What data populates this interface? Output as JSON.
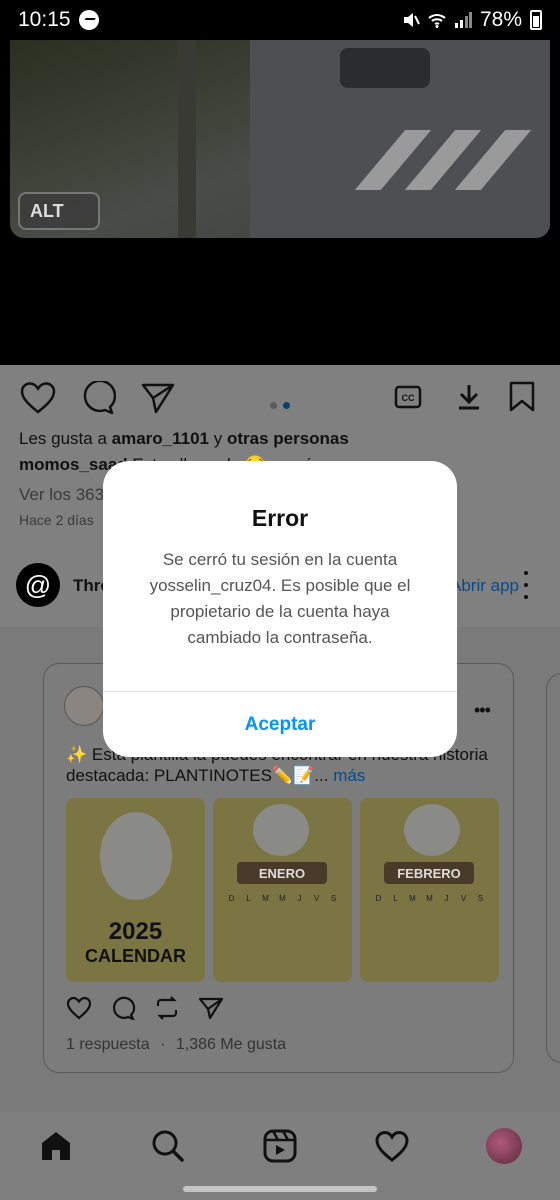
{
  "status_bar": {
    "time": "10:15",
    "battery": "78%",
    "icons": [
      "messenger-icon",
      "mute-icon",
      "wifi-icon",
      "signal-icon",
      "battery-icon"
    ]
  },
  "post": {
    "alt_badge": "ALT",
    "carousel": {
      "total": 2,
      "active": 1
    },
    "likes_prefix": "Les gusta a ",
    "likes_user": "amaro_1101",
    "likes_mid": " y ",
    "likes_others": "otras personas",
    "caption_user": "momos_saad",
    "caption_text": " Estoy llorando 😂 ... más",
    "comments_link": "Ver los 363 comentarios",
    "time_ago": "Hace 2 días"
  },
  "threads": {
    "name": "Threads",
    "open_app": "Abrir app",
    "post_text": "✨ Esta plantilla la puedes encontrar en nuestra historia destacada: PLANTINOTES✏️📝...",
    "more_link": " más",
    "images": [
      {
        "title_line1": "2025",
        "title_line2": "CALENDAR"
      },
      {
        "month": "ENERO"
      },
      {
        "month": "FEBRERO"
      }
    ],
    "weekdays": [
      "D",
      "L",
      "M",
      "M",
      "J",
      "V",
      "S"
    ],
    "replies": "1 respuesta",
    "separator": "·",
    "likes": "1,386 Me gusta"
  },
  "dialog": {
    "title": "Error",
    "message": "Se cerró tu sesión en la cuenta yosselin_cruz04. Es posible que el propietario de la cuenta haya cambiado la contraseña.",
    "button": "Aceptar"
  },
  "colors": {
    "accent": "#0095f6",
    "overlay_bg": "#7f7f7f"
  }
}
